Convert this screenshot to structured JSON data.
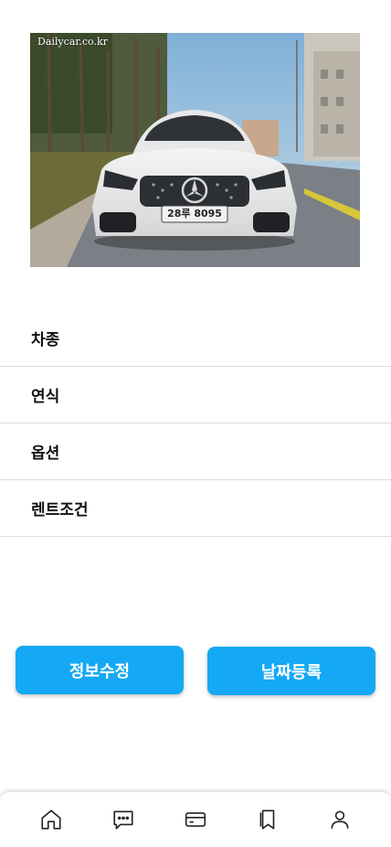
{
  "car_image": {
    "watermark": "Dailycar.co.kr",
    "plate": "28루 8095"
  },
  "info_rows": [
    {
      "label": "차종"
    },
    {
      "label": "연식"
    },
    {
      "label": "옵션"
    },
    {
      "label": "렌트조건"
    }
  ],
  "buttons": {
    "edit_info": "정보수정",
    "register_date": "날짜등록"
  },
  "tab_bar": {
    "items": [
      {
        "icon": "home-icon"
      },
      {
        "icon": "chat-icon"
      },
      {
        "icon": "card-icon"
      },
      {
        "icon": "bookmark-icon"
      },
      {
        "icon": "user-icon"
      }
    ]
  },
  "colors": {
    "accent": "#14a8f5",
    "divider": "#dcdcdc"
  }
}
